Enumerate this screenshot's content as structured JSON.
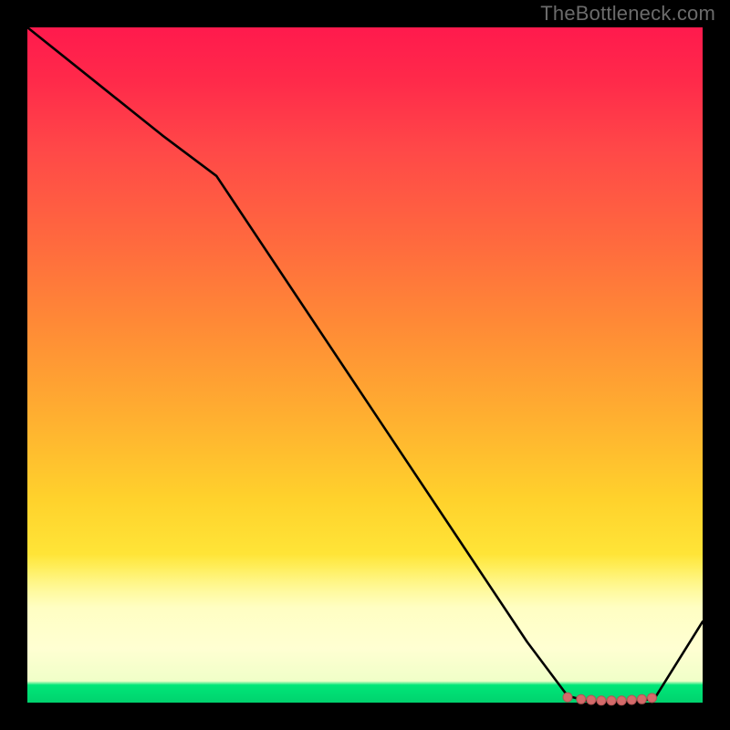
{
  "attribution": "TheBottleneck.com",
  "chart_data": {
    "type": "line",
    "title": "",
    "xlabel": "",
    "ylabel": "",
    "xlim": [
      0,
      100
    ],
    "ylim": [
      0,
      100
    ],
    "x": [
      0,
      10,
      20,
      28,
      40,
      52,
      64,
      74,
      80,
      83,
      85,
      87,
      89,
      91,
      93,
      100
    ],
    "values": [
      100,
      92,
      84,
      78,
      60,
      42,
      24,
      9,
      1,
      0.2,
      0.1,
      0.1,
      0.1,
      0.2,
      0.8,
      12
    ],
    "markers": {
      "x": [
        80,
        82,
        83.5,
        85,
        86.5,
        88,
        89.5,
        91,
        92.5
      ],
      "values": [
        0.8,
        0.5,
        0.4,
        0.3,
        0.3,
        0.3,
        0.4,
        0.5,
        0.7
      ]
    },
    "colors": {
      "line": "#000000",
      "marker_fill": "#d46a6a",
      "marker_stroke": "#b25454",
      "gradient_top": "#ff1a4d",
      "gradient_mid": "#ffd22c",
      "gradient_band": "#ffffc8",
      "gradient_bottom": "#00d878"
    }
  }
}
